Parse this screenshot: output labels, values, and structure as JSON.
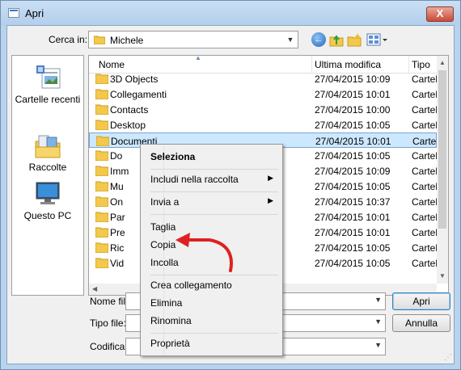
{
  "window": {
    "title": "Apri",
    "close_symbol": "X"
  },
  "lookin": {
    "label": "Cerca in:",
    "value": "Michele"
  },
  "places": [
    {
      "label": "Cartelle recenti",
      "icon": "recent-places-icon"
    },
    {
      "label": "Raccolte",
      "icon": "libraries-icon"
    },
    {
      "label": "Questo PC",
      "icon": "computer-icon"
    }
  ],
  "columns": {
    "name": "Nome",
    "date": "Ultima modifica",
    "type": "Tipo"
  },
  "files": [
    {
      "name": "3D Objects",
      "date": "27/04/2015 10:09",
      "type": "Cartell",
      "icon": "folder-icon"
    },
    {
      "name": "Collegamenti",
      "date": "27/04/2015 10:01",
      "type": "Cartell",
      "icon": "links-folder-icon"
    },
    {
      "name": "Contacts",
      "date": "27/04/2015 10:00",
      "type": "Cartell",
      "icon": "contacts-folder-icon"
    },
    {
      "name": "Desktop",
      "date": "27/04/2015 10:05",
      "type": "Cartell",
      "icon": "desktop-folder-icon"
    },
    {
      "name": "Documenti",
      "date": "27/04/2015 10:01",
      "type": "Cartell",
      "icon": "documents-folder-icon"
    },
    {
      "name": "Do",
      "date": "27/04/2015 10:05",
      "type": "Cartell",
      "icon": "downloads-folder-icon"
    },
    {
      "name": "Imm",
      "date": "27/04/2015 10:09",
      "type": "Cartell",
      "icon": "pictures-folder-icon"
    },
    {
      "name": "Mu",
      "date": "27/04/2015 10:05",
      "type": "Cartell",
      "icon": "music-folder-icon"
    },
    {
      "name": "On",
      "date": "27/04/2015 10:37",
      "type": "Cartell",
      "icon": "onedrive-folder-icon"
    },
    {
      "name": "Par",
      "date": "27/04/2015 10:01",
      "type": "Cartell",
      "icon": "saved-games-folder-icon"
    },
    {
      "name": "Pre",
      "date": "27/04/2015 10:01",
      "type": "Cartell",
      "icon": "favorites-folder-icon"
    },
    {
      "name": "Ric",
      "date": "27/04/2015 10:05",
      "type": "Cartell",
      "icon": "searches-folder-icon"
    },
    {
      "name": "Vid",
      "date": "27/04/2015 10:05",
      "type": "Cartell",
      "icon": "videos-folder-icon"
    }
  ],
  "selected_index": 4,
  "bottom": {
    "filename_label": "Nome file",
    "filetype_label": "Tipo file:",
    "encoding_label": "Codifica:",
    "open_button": "Apri",
    "cancel_button": "Annulla"
  },
  "context_menu": [
    {
      "label": "Seleziona",
      "bold": true
    },
    {
      "separator": true
    },
    {
      "label": "Includi nella raccolta",
      "submenu": true
    },
    {
      "separator": true
    },
    {
      "label": "Invia a",
      "submenu": true
    },
    {
      "separator": true
    },
    {
      "label": "Taglia"
    },
    {
      "label": "Copia"
    },
    {
      "label": "Incolla"
    },
    {
      "separator": true
    },
    {
      "label": "Crea collegamento"
    },
    {
      "label": "Elimina"
    },
    {
      "label": "Rinomina"
    },
    {
      "separator": true
    },
    {
      "label": "Proprietà"
    }
  ],
  "annotation_color": "#e02020"
}
